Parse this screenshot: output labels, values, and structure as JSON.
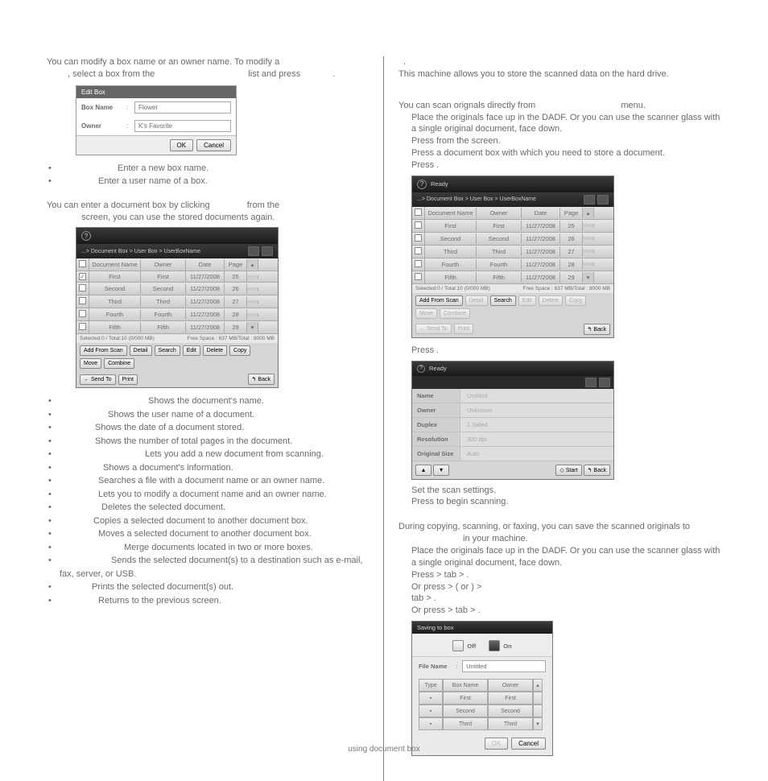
{
  "left": {
    "intro1": "You can modify a box name or an owner name. To modify a",
    "intro2": ", select a box from the",
    "intro3": "list and press",
    "intro4": ".",
    "editbox": {
      "title": "Edit Box",
      "boxname_label": "Box Name",
      "boxname_value": "Flower",
      "owner_label": "Owner",
      "owner_value": "K's Favorite",
      "ok": "OK",
      "cancel": "Cancel"
    },
    "sub_bullets": {
      "b1": "Enter a new box name.",
      "b2": "Enter a user name of a box."
    },
    "enter_doc_1": "You can enter a document box by clicking",
    "enter_doc_2": "from the",
    "enter_doc_3": "screen, you can use the stored documents again.",
    "doclist": {
      "breadcrumb": "...> Document Box > User Box > UserBoxName",
      "cols": {
        "name": "Document Name",
        "owner": "Owner",
        "date": "Date",
        "page": "Page"
      },
      "rows": [
        {
          "name": "First",
          "owner": "First",
          "date": "11/27/2008",
          "page": "25",
          "checked": true
        },
        {
          "name": "Second",
          "owner": "Second",
          "date": "11/27/2008",
          "page": "26",
          "checked": false
        },
        {
          "name": "Third",
          "owner": "Third",
          "date": "11/27/2008",
          "page": "27",
          "checked": false
        },
        {
          "name": "Fourth",
          "owner": "Fourth",
          "date": "11/27/2008",
          "page": "28",
          "checked": false
        },
        {
          "name": "Fifth",
          "owner": "Fifth",
          "date": "11/27/2008",
          "page": "29",
          "checked": false
        }
      ],
      "status_left": "Selected:0   / Total:10 (0/000 MB)",
      "status_right": "Free Space : 637 MB/Total : 8000 MB",
      "btns": {
        "add": "Add From Scan",
        "detail": "Detail",
        "search": "Search",
        "edit": "Edit",
        "delete": "Delete",
        "copy": "Copy",
        "move": "Move",
        "combine": "Combine",
        "sendto": "← Send To",
        "print": "Print",
        "back": "↰  Back"
      }
    },
    "defs": [
      "Shows the document's name.",
      "Shows the user name of a document.",
      "Shows the date of a document stored.",
      "Shows the number of total pages in the document.",
      "Lets you add a new document from scanning.",
      "Shows a document's information.",
      "Searches a file with a document name or an owner name.",
      "Lets you to modify a document name and an owner name.",
      "Deletes the selected document.",
      "Copies a selected document to another document box.",
      "Moves a selected document to another document box.",
      "Merge documents located in two or more boxes.",
      "Sends the selected document(s) to a destination such as e-mail, fax, server, or USB.",
      "Prints the selected document(s) out.",
      "Returns to the previous screen."
    ]
  },
  "right": {
    "line0": ".",
    "line1": "This machine allows you to store the scanned data on the hard drive.",
    "scan_from_1": "You can scan orignals directly from",
    "scan_from_2": "menu.",
    "steps1": [
      "Place the originals face up in the DADF. Or you can use the scanner glass with a single original document, face down.",
      "Press                              from the              screen.",
      "Press a document box with which you need to store a document.",
      "Press         ."
    ],
    "doclist2": {
      "ready": "Ready",
      "breadcrumb": "...> Document Box > User Box > UserBoxName",
      "cols": {
        "name": "Document Name",
        "owner": "Owner",
        "date": "Date",
        "page": "Page"
      },
      "rows": [
        {
          "name": "First",
          "owner": "First",
          "date": "11/27/2008",
          "page": "25"
        },
        {
          "name": "Second",
          "owner": "Second",
          "date": "11/27/2008",
          "page": "26"
        },
        {
          "name": "Third",
          "owner": "Third",
          "date": "11/27/2008",
          "page": "27"
        },
        {
          "name": "Fourth",
          "owner": "Fourth",
          "date": "11/27/2008",
          "page": "28"
        },
        {
          "name": "Fifth",
          "owner": "Fifth",
          "date": "11/27/2008",
          "page": "29"
        }
      ],
      "status_left": "Selected:0   / Total:10 (0/000 MB)",
      "status_right": "Free Space : 637 MB/Total : 8000 MB",
      "btns": {
        "add": "Add From Scan",
        "detail": "Detail",
        "search": "Search",
        "edit": "Edit",
        "delete": "Delete",
        "copy": "Copy",
        "move": "Move",
        "combine": "Combine",
        "sendto": "← Send To",
        "print": "Print",
        "back": "↰  Back"
      }
    },
    "press_line": "Press                            .",
    "settings": {
      "ready": "Ready",
      "rows": [
        {
          "label": "Name",
          "value": "Untitled"
        },
        {
          "label": "Owner",
          "value": "Unknown"
        },
        {
          "label": "Duplex",
          "value": "1 Sided"
        },
        {
          "label": "Resolution",
          "value": "300 dpi"
        },
        {
          "label": "Original Size",
          "value": "Auto"
        }
      ],
      "start": "◇ Start",
      "back": "↰  Back"
    },
    "after_settings_1": "Set the scan settings.",
    "after_settings_2": "Press           to begin scanning.",
    "during_1": "During copying, scanning, or faxing, you can save the scanned originals to",
    "during_2": "in your machine.",
    "steps2_a": "Place the originals face up in the DADF. Or you can use the scanner glass with a single original document, face down.",
    "steps2_b1": "Press           >              tab >                          .",
    "steps2_b2": "Or press         >                       (                     or                    ) >",
    "steps2_b3": "        tab >                         .",
    "steps2_b4": "Or press         >              tab >                          .",
    "savebox": {
      "title": "Saving to box",
      "off": "Off",
      "on": "On",
      "filename_label": "File Name",
      "filename_value": "Untitled",
      "cols": {
        "type": "Type",
        "boxname": "Box Name",
        "owner": "Owner"
      },
      "rows": [
        {
          "name": "First",
          "owner": "First"
        },
        {
          "name": "Second",
          "owner": "Second"
        },
        {
          "name": "Third",
          "owner": "Third"
        }
      ],
      "ok": "OK",
      "cancel": "Cancel"
    }
  },
  "footer": "using document box"
}
